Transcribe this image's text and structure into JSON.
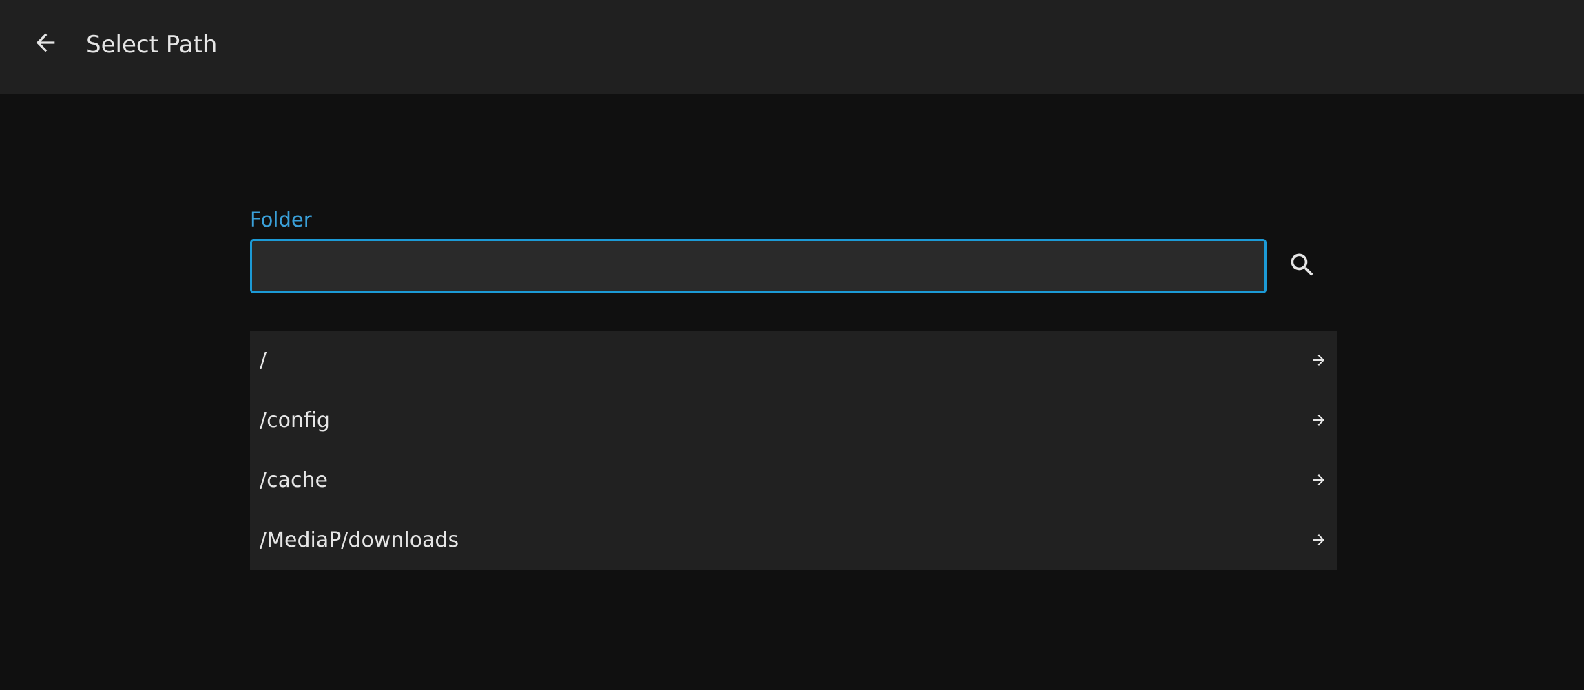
{
  "header": {
    "back_icon": "arrow-left-icon",
    "title": "Select Path"
  },
  "folder": {
    "label": "Folder",
    "value": "",
    "placeholder": "",
    "search_icon": "search-icon"
  },
  "paths": [
    {
      "label": "/",
      "icon": "arrow-right-icon"
    },
    {
      "label": "/config",
      "icon": "arrow-right-icon"
    },
    {
      "label": "/cache",
      "icon": "arrow-right-icon"
    },
    {
      "label": "/MediaP/downloads",
      "icon": "arrow-right-icon"
    }
  ],
  "colors": {
    "background": "#101010",
    "header": "#202020",
    "accent": "#1c9ad6",
    "list_background": "#212121",
    "text": "#e6e6e6"
  }
}
